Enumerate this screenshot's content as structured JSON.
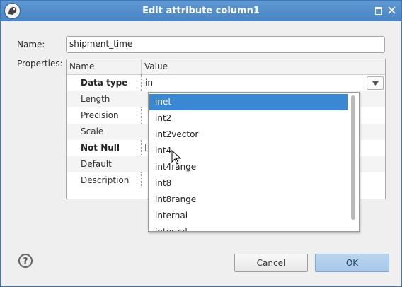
{
  "window": {
    "title": "Edit attribute column1",
    "accent": "#4a86c5"
  },
  "form": {
    "name_label": "Name:",
    "name_value": "shipment_time",
    "properties_label": "Properties:"
  },
  "table": {
    "headers": [
      "Name",
      "Value"
    ],
    "rows": [
      {
        "name": "Data type",
        "value": "in",
        "bold": true
      },
      {
        "name": "Length",
        "value": ""
      },
      {
        "name": "Precision",
        "value": ""
      },
      {
        "name": "Scale",
        "value": ""
      },
      {
        "name": "Not Null",
        "value": "",
        "bold": true
      },
      {
        "name": "Default",
        "value": ""
      },
      {
        "name": "Description",
        "value": ""
      }
    ]
  },
  "dropdown": {
    "selected": "inet",
    "options": [
      "inet",
      "int2",
      "int2vector",
      "int4",
      "int4range",
      "int8",
      "int8range",
      "internal",
      "interval"
    ]
  },
  "buttons": {
    "cancel": "Cancel",
    "ok": "OK",
    "help": "?"
  },
  "icons": [
    "app-icon",
    "maximize-icon",
    "close-icon",
    "dropdown-arrow-icon",
    "help-icon",
    "mouse-cursor-icon"
  ]
}
